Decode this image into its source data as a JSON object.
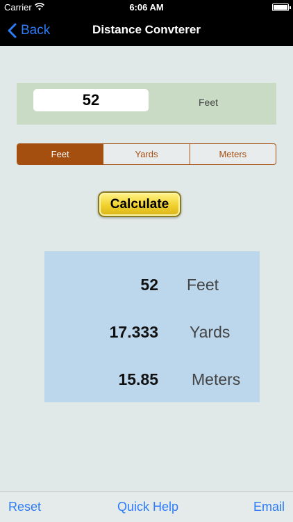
{
  "status_bar": {
    "carrier": "Carrier",
    "time": "6:06 AM"
  },
  "nav": {
    "back_label": "Back",
    "title": "Distance Convterer"
  },
  "input": {
    "value": "52",
    "unit_label": "Feet"
  },
  "segments": [
    {
      "label": "Feet",
      "selected": true
    },
    {
      "label": "Yards",
      "selected": false
    },
    {
      "label": "Meters",
      "selected": false
    }
  ],
  "calculate_label": "Calculate",
  "results": [
    {
      "value": "52",
      "unit": "Feet"
    },
    {
      "value": "17.333",
      "unit": "Yards"
    },
    {
      "value": "15.85",
      "unit": "Meters"
    }
  ],
  "toolbar": {
    "reset_label": "Reset",
    "help_label": "Quick Help",
    "email_label": "Email"
  },
  "colors": {
    "accent": "#2d7cf6",
    "segment": "#a44f10",
    "input_panel": "#c9dbc5",
    "results_panel": "#bcd6ec",
    "button_gold": "#f2d12e"
  }
}
